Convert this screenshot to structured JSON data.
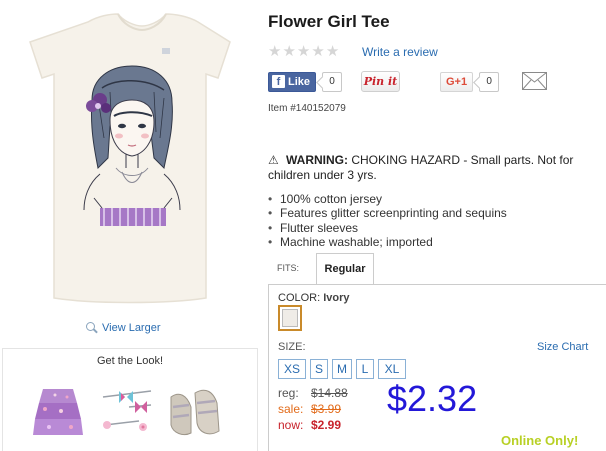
{
  "product": {
    "title": "Flower Girl Tee",
    "item_number": "Item #140152079",
    "rating_stars": 0,
    "image_icon": "girl-portrait-tee-image"
  },
  "reviews": {
    "write_review": "Write a review"
  },
  "social": {
    "facebook_like": "Like",
    "facebook_count": "0",
    "pinterest": "Pin it",
    "google_plus": "G+1",
    "google_count": "0",
    "mail_icon": "envelope-icon"
  },
  "warning": {
    "prefix": "WARNING:",
    "text": " CHOKING HAZARD - Small parts. Not for children under 3 yrs."
  },
  "features": [
    "100% cotton jersey",
    "Features glitter screenprinting and sequins",
    "Flutter sleeves",
    "Machine washable; imported"
  ],
  "fits": {
    "label": "FITS:",
    "selected": "Regular"
  },
  "color": {
    "label": "COLOR:",
    "value": "Ivory",
    "swatch_hex": "#efece7"
  },
  "size": {
    "label": "SIZE:",
    "chart_link": "Size Chart",
    "options": [
      "XS",
      "S",
      "M",
      "L",
      "XL"
    ]
  },
  "pricing": {
    "reg_label": "reg:",
    "reg_price": "$14.88",
    "sale_label": "sale:",
    "sale_price": "$3.99",
    "now_label": "now:",
    "now_price": "$2.99",
    "highlight_price": "$2.32",
    "online_only": "Online Only!"
  },
  "view_larger": "View Larger",
  "get_the_look": {
    "title": "Get the Look!",
    "items": [
      "purple-floral-skirt-image",
      "butterfly-hair-clips-image",
      "silver-sandals-image"
    ]
  },
  "colors": {
    "link": "#2a6cb0",
    "accent_price": "#2318d8",
    "sale": "#e26b1a",
    "now": "#c8232c",
    "online_only": "#b8d025"
  }
}
